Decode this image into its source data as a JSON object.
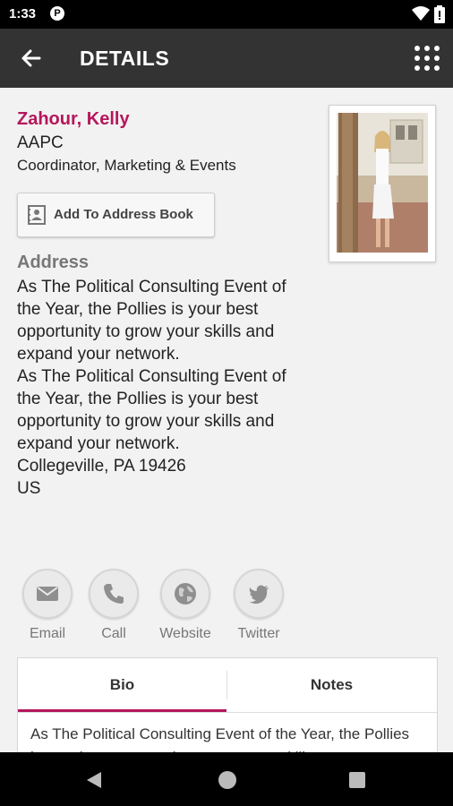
{
  "status_bar": {
    "time": "1:33",
    "app_icon_letter": "P"
  },
  "toolbar": {
    "title": "DETAILS"
  },
  "contact": {
    "name": "Zahour, Kelly",
    "organization": "AAPC",
    "job_title": "Coordinator, Marketing & Events",
    "add_to_address_book_label": "Add To Address Book"
  },
  "address": {
    "heading": "Address",
    "line1": "As The Political Consulting Event of the Year, the Pollies is your best opportunity to grow your skills and expand your network.",
    "line2": "As The Political Consulting Event of the Year, the Pollies is your best opportunity to grow your skills and expand your network.",
    "city_line": "Collegeville, PA 19426",
    "country": "US"
  },
  "actions": [
    {
      "label": "Email",
      "icon": "envelope-icon"
    },
    {
      "label": "Call",
      "icon": "phone-icon"
    },
    {
      "label": "Website",
      "icon": "globe-icon"
    },
    {
      "label": "Twitter",
      "icon": "twitter-icon"
    }
  ],
  "tabs": {
    "bio_label": "Bio",
    "notes_label": "Notes",
    "bio_text": "As The Political Consulting Event of the Year, the Pollies is your best opportunity to grow your skills"
  },
  "colors": {
    "accent": "#b5175b",
    "toolbar": "#333333",
    "background": "#f2f2f2"
  }
}
